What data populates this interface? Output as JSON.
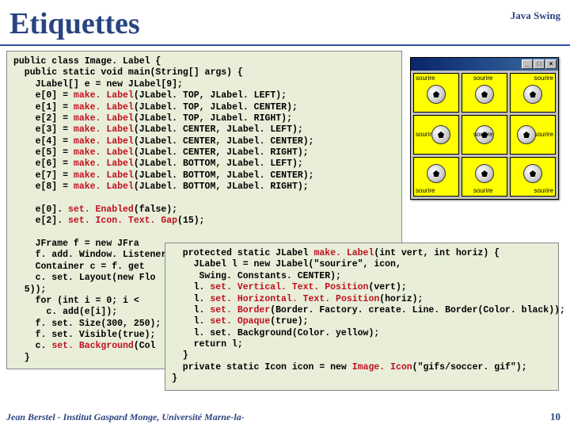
{
  "header": {
    "title": "Etiquettes",
    "subtitle": "Java Swing"
  },
  "code_main": {
    "l1": "public class Image. Label {",
    "l2": "  public static void main(String[] args) {",
    "l3": "    JLabel[] e = new JLabel[9];",
    "l4a": "    e[0] = ",
    "l4b": "make. Label",
    "l4c": "(JLabel. TOP, JLabel. LEFT);",
    "l5a": "    e[1] = ",
    "l5b": "make. Label",
    "l5c": "(JLabel. TOP, JLabel. CENTER);",
    "l6a": "    e[2] = ",
    "l6b": "make. Label",
    "l6c": "(JLabel. TOP, JLabel. RIGHT);",
    "l7a": "    e[3] = ",
    "l7b": "make. Label",
    "l7c": "(JLabel. CENTER, JLabel. LEFT);",
    "l8a": "    e[4] = ",
    "l8b": "make. Label",
    "l8c": "(JLabel. CENTER, JLabel. CENTER);",
    "l9a": "    e[5] = ",
    "l9b": "make. Label",
    "l9c": "(JLabel. CENTER, JLabel. RIGHT);",
    "l10a": "    e[6] = ",
    "l10b": "make. Label",
    "l10c": "(JLabel. BOTTOM, JLabel. LEFT);",
    "l11a": "    e[7] = ",
    "l11b": "make. Label",
    "l11c": "(JLabel. BOTTOM, JLabel. CENTER);",
    "l12a": "    e[8] = ",
    "l12b": "make. Label",
    "l12c": "(JLabel. BOTTOM, JLabel. RIGHT);",
    "blank1": "",
    "l13a": "    e[0]. ",
    "l13b": "set. Enabled",
    "l13c": "(false);",
    "l14a": "    e[2]. ",
    "l14b": "set. Icon. Text. Gap",
    "l14c": "(15);",
    "blank2": "",
    "l15": "    JFrame f = new JFra",
    "l16": "    f. add. Window. Listener",
    "l17": "    Container c = f. get",
    "l18": "    c. set. Layout(new Flo",
    "l19": "  5));",
    "l20": "    for (int i = 0; i <",
    "l21": "      c. add(e[i]);",
    "l22": "    f. set. Size(300, 250);",
    "l23": "    f. set. Visible(true);",
    "l24a": "    c. ",
    "l24b": "set. Background",
    "l24c": "(Col",
    "l25": "  }"
  },
  "code_inset": {
    "l1a": "  protected static JLabel ",
    "l1b": "make. Label",
    "l1c": "(int vert, int horiz) {",
    "l2": "    JLabel l = new JLabel(\"sourire\", icon,",
    "l3": "     Swing. Constants. CENTER);",
    "l4a": "    l. ",
    "l4b": "set. Vertical. Text. Position",
    "l4c": "(vert);",
    "l5a": "    l. ",
    "l5b": "set. Horizontal. Text. Position",
    "l5c": "(horiz);",
    "l6a": "    l. ",
    "l6b": "set. Border",
    "l6c": "(Border. Factory. create. Line. Border(Color. black));",
    "l7a": "    l. ",
    "l7b": "set. Opaque",
    "l7c": "(true);",
    "l8": "    l. set. Background(Color. yellow);",
    "l9": "    return l;",
    "l10": "  }",
    "l11a": "  private static Icon icon = new ",
    "l11b": "Image. Icon",
    "l11c": "(\"gifs/soccer. gif\");",
    "l12": "}"
  },
  "window": {
    "min": "_",
    "max": "□",
    "close": "×",
    "cell_label": "sourire"
  },
  "footer": {
    "left": "Jean Berstel -  Institut Gaspard Monge, Université Marne-la-",
    "page": "10"
  }
}
